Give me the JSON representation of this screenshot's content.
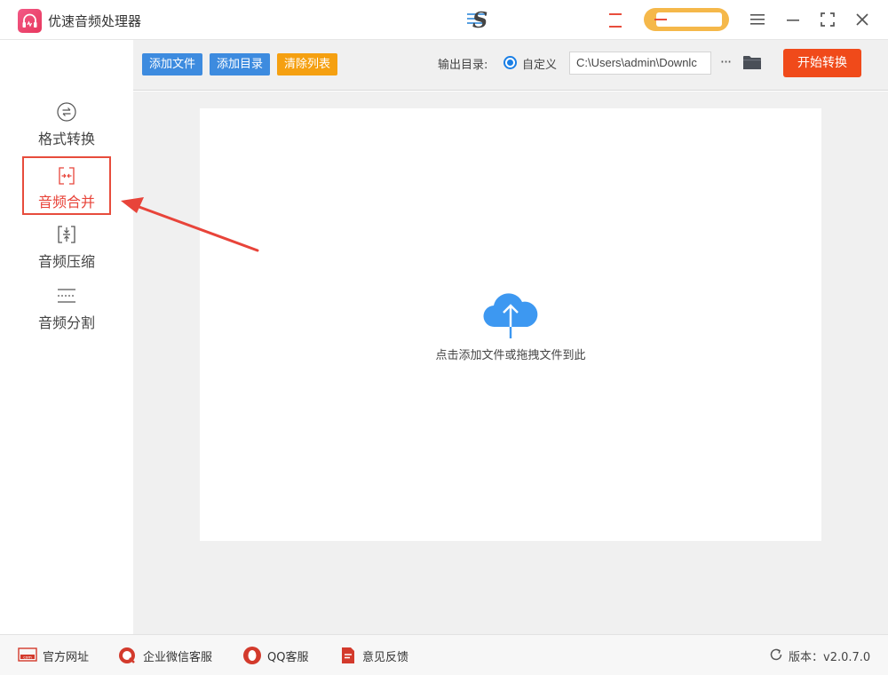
{
  "app": {
    "title": "优速音频处理器"
  },
  "window_controls": {
    "menu_icon": "menu-icon",
    "minimize_icon": "minimize-icon",
    "maximize_icon": "maximize-icon",
    "close_icon": "close-icon"
  },
  "sidebar": {
    "items": [
      {
        "label": "格式转换",
        "icon": "format-convert-icon",
        "active": false
      },
      {
        "label": "音频合并",
        "icon": "audio-merge-icon",
        "active": true
      },
      {
        "label": "音频压缩",
        "icon": "audio-compress-icon",
        "active": false
      },
      {
        "label": "音频分割",
        "icon": "audio-split-icon",
        "active": false
      }
    ]
  },
  "toolbar": {
    "add_file": "添加文件",
    "add_dir": "添加目录",
    "clear_list": "清除列表",
    "output_label": "输出目录:",
    "output_option": "自定义",
    "output_path": "C:\\Users\\admin\\Downlc",
    "more": "···",
    "start": "开始转换"
  },
  "dropzone": {
    "hint": "点击添加文件或拖拽文件到此"
  },
  "footer": {
    "website": "官方网址",
    "wechat": "企业微信客服",
    "qq": "QQ客服",
    "feedback": "意见反馈",
    "version": "版本：v2.0.7.0"
  },
  "colors": {
    "accent_blue": "#3d8bdf",
    "clear_orange": "#f5a011",
    "start_red": "#f04a1a",
    "active_red": "#e74c3c",
    "cloud_blue": "#3d98f1"
  }
}
